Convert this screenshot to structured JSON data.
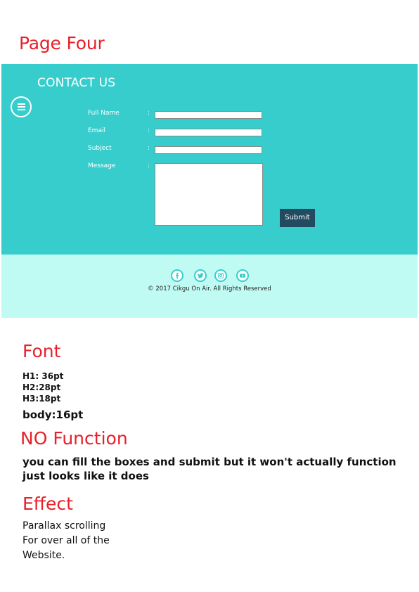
{
  "page": {
    "title": "Page Four"
  },
  "contact": {
    "heading": "CONTACT US",
    "menu_icon": "hamburger-menu-icon",
    "fields": [
      {
        "label": "Full Name",
        "colon": ":",
        "value": "",
        "placeholder": ""
      },
      {
        "label": "Email",
        "colon": ":",
        "value": "",
        "placeholder": ""
      },
      {
        "label": "Subject",
        "colon": ":",
        "value": "",
        "placeholder": ""
      },
      {
        "label": "Message",
        "colon": ":",
        "value": "",
        "placeholder": ""
      }
    ],
    "submit_label": "Submit"
  },
  "footer": {
    "social_icons": [
      "facebook-icon",
      "twitter-icon",
      "instagram-icon",
      "youtube-icon"
    ],
    "copyright": "© 2017 Cikgu On Air. All Rights Reserved"
  },
  "notes": {
    "font_heading": "Font",
    "font_specs": [
      "H1: 36pt",
      "H2:28pt",
      "H3:18pt"
    ],
    "body_spec": "body:16pt",
    "function_heading": "NO Function",
    "function_text_line1": "you can fill the boxes and submit but it won't actually function",
    "function_text_line2": "just looks like it does",
    "effect_heading": "Effect",
    "effect_lines": [
      "Parallax scrolling",
      "For over all of the",
      "Website."
    ]
  },
  "colors": {
    "accent_red": "#e8202a",
    "contact_bg": "#38cdcd",
    "footer_bg": "#c0fbf3",
    "submit_bg": "#234b60"
  }
}
